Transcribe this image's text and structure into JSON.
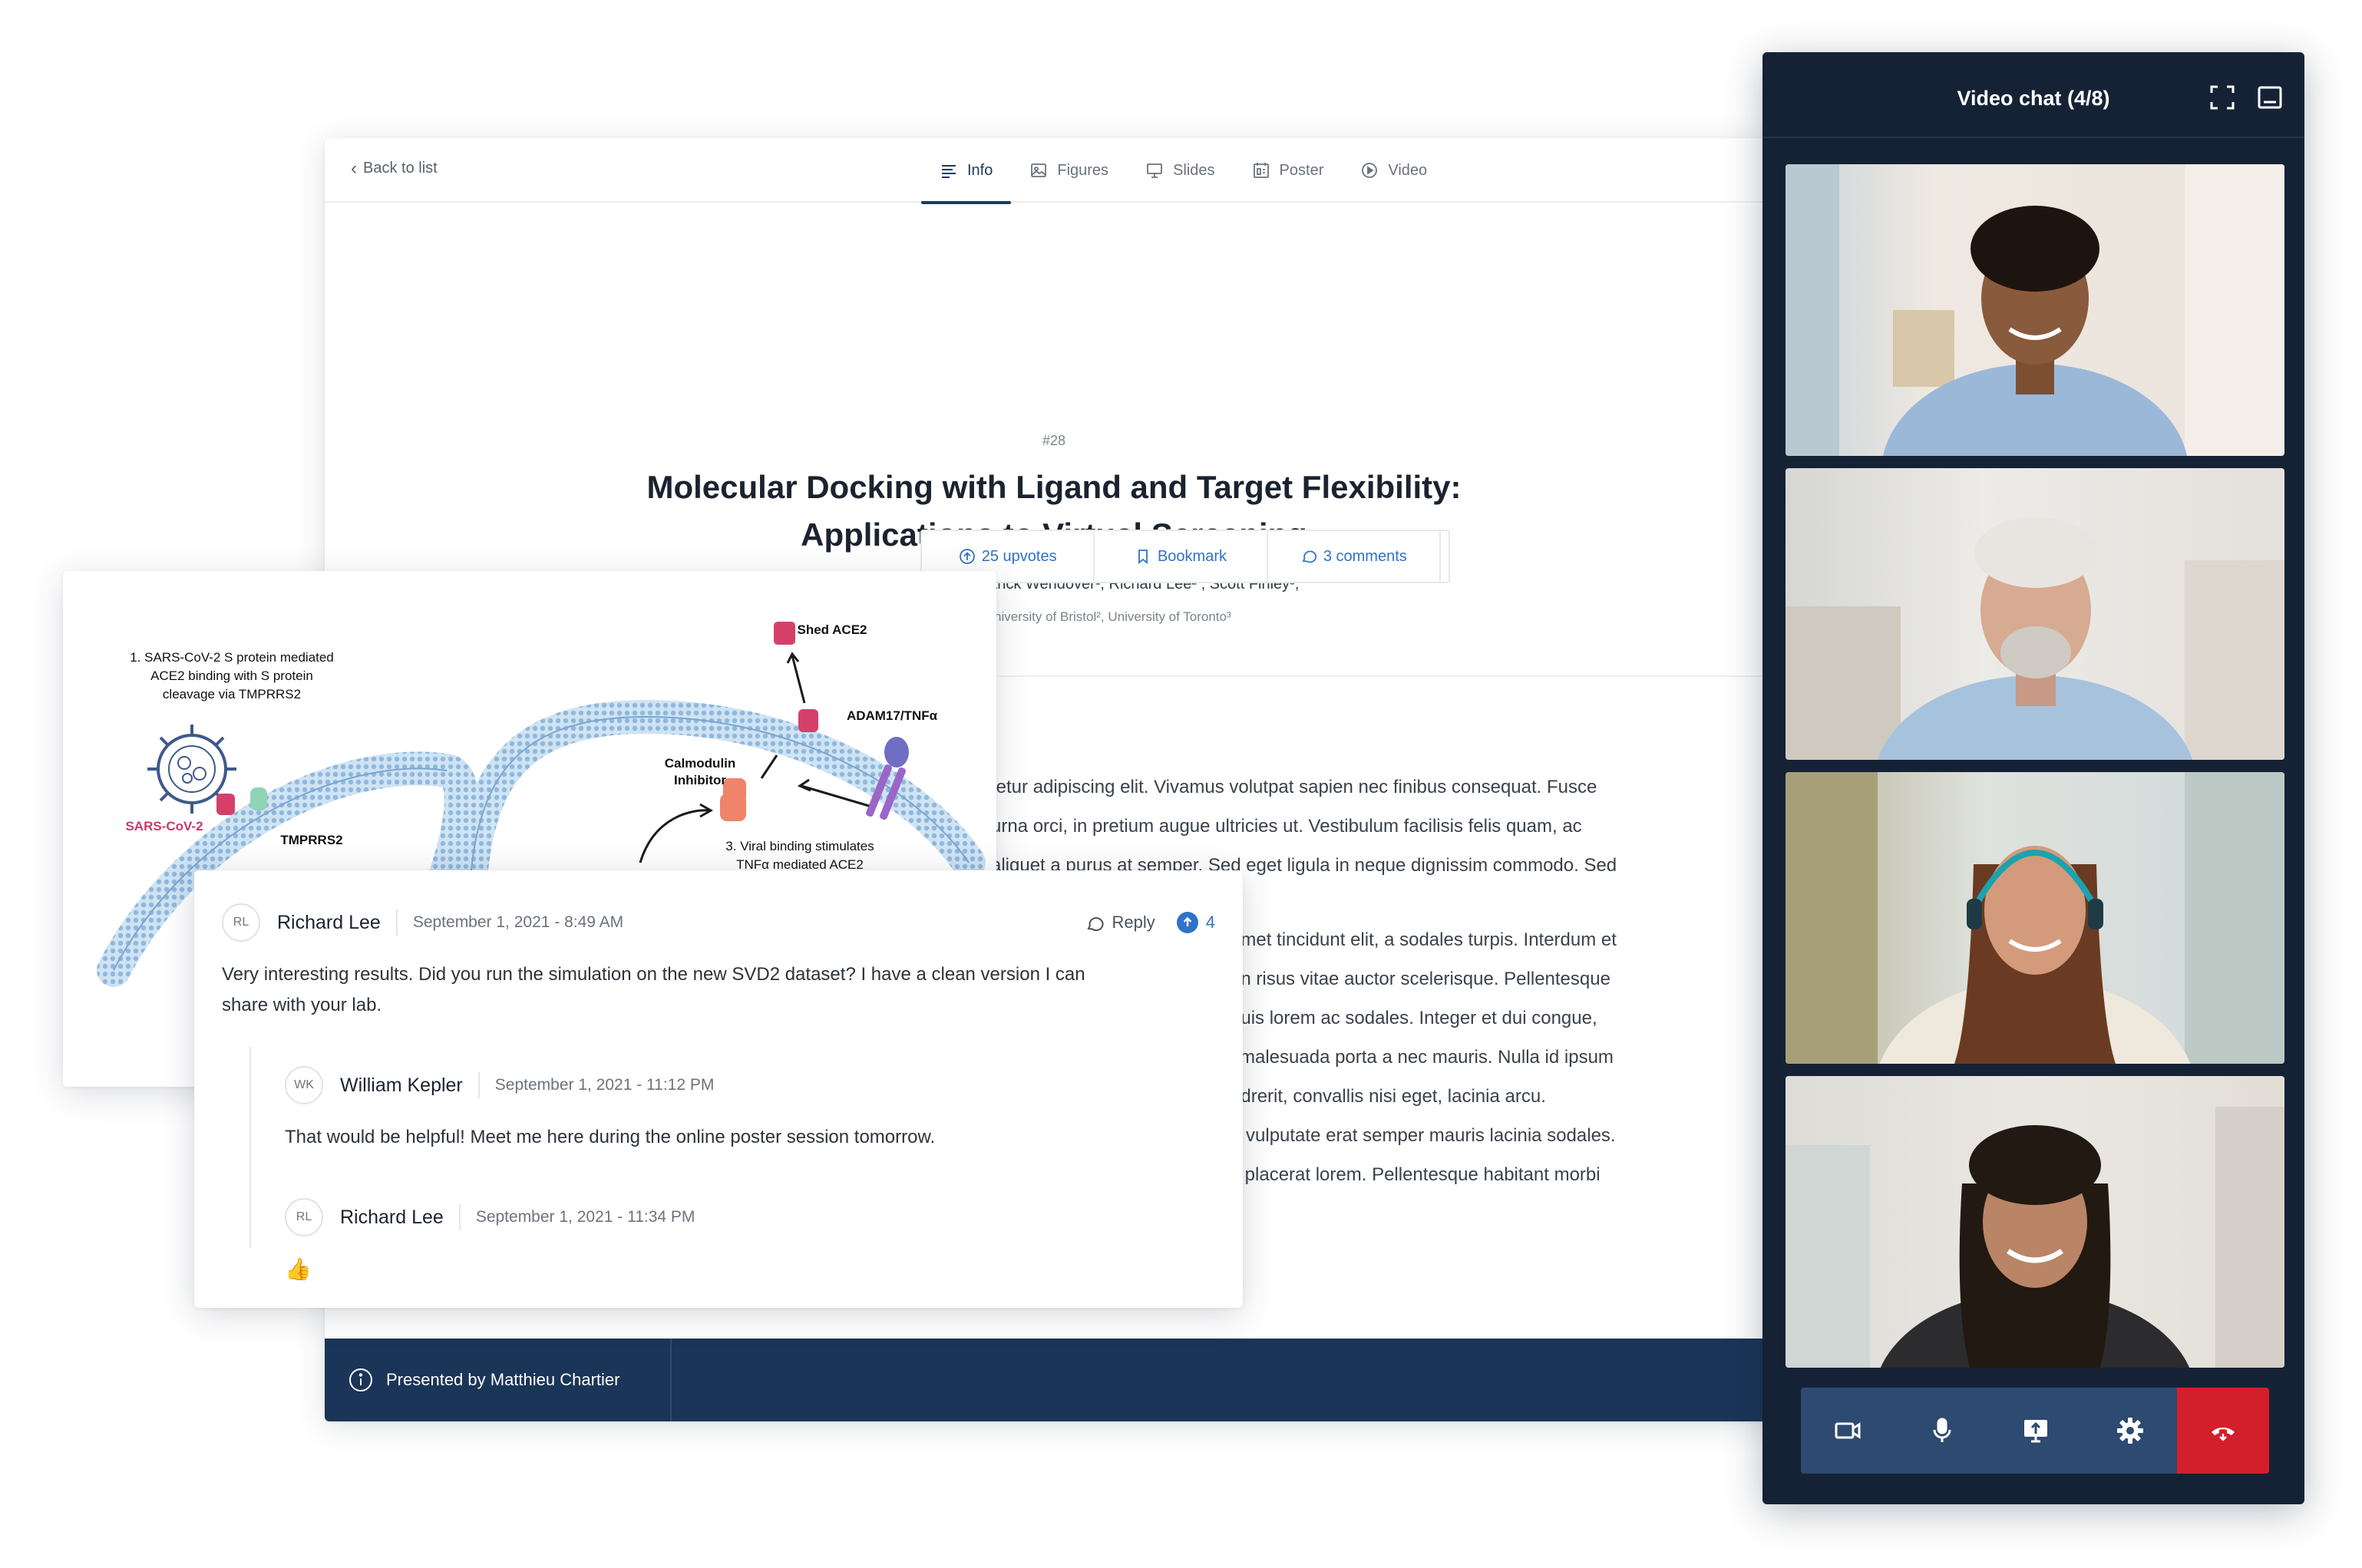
{
  "main": {
    "back_label": "Back to list",
    "tabs": [
      {
        "label": "Info",
        "icon": "info-lines-icon",
        "active": true
      },
      {
        "label": "Figures",
        "icon": "image-icon"
      },
      {
        "label": "Slides",
        "icon": "presentation-icon"
      },
      {
        "label": "Poster",
        "icon": "poster-icon"
      },
      {
        "label": "Video",
        "icon": "play-circle-icon"
      }
    ],
    "poster_number": "#28",
    "title_line1": "Molecular Docking with Ligand and Target Flexibility:",
    "title_line2": "Applications to Virtual Screening",
    "authors": "Francesco Gaudreault¹, Patrick Wendover¹, Richard Lee² , Scott Finley³,",
    "affiliations": "¹McGill University, University of Bristol², University of Toronto³",
    "actions": {
      "upvotes": "25 upvotes",
      "bookmark": "Bookmark",
      "comments": "3 comments"
    },
    "body_paragraph1": [
      "tetur adipiscing elit. Vivamus volutpat sapien nec finibus consequat. Fusce",
      "urna orci, in pretium augue ultricies ut. Vestibulum facilisis felis quam, ac",
      "aliquet a purus at semper. Sed eget ligula in neque dignissim commodo. Sed"
    ],
    "body_paragraph2": [
      "amet tincidunt elit, a sodales turpis. Interdum et",
      "an risus vitae auctor scelerisque. Pellentesque",
      "quis lorem ac sodales. Integer et dui congue,",
      "i malesuada porta a nec mauris. Nulla id ipsum",
      "ndrerit, convallis nisi eget, lacinia arcu.",
      "n vulputate erat semper mauris lacinia sodales.",
      "s placerat lorem. Pellentesque habitant morbi",
      "."
    ],
    "presented_by": "Presented by Matthieu Chartier"
  },
  "figure": {
    "step1": [
      "1. SARS-CoV-2 S protein mediated",
      "ACE2 binding with S protein",
      "cleavage via TMPRRS2"
    ],
    "virus_label": "SARS-CoV-2",
    "tmprss2_label": "TMPRRS2",
    "shed_ace2": "Shed ACE2",
    "adam17": "ADAM17/TNFα",
    "calmodulin": [
      "Calmodulin",
      "Inhibitor"
    ],
    "step3": [
      "3. Viral binding stimulates",
      "TNFα mediated ACE2"
    ]
  },
  "comments": {
    "reply_label": "Reply",
    "upvote_count": "4",
    "items": [
      {
        "initials": "RL",
        "name": "Richard Lee",
        "date": "September 1, 2021 - 8:49 AM",
        "text_line1": "Very interesting results. Did you run the simulation on the new SVD2 dataset? I have a clean version I can",
        "text_line2": "share with your lab."
      },
      {
        "initials": "WK",
        "name": "William Kepler",
        "date": "September 1, 2021 - 11:12 PM",
        "text": "That would be helpful! Meet me here during the online poster session tomorrow."
      },
      {
        "initials": "RL",
        "name": "Richard Lee",
        "date": "September 1, 2021 - 11:34 PM",
        "text": "👍"
      }
    ]
  },
  "video_chat": {
    "title": "Video chat (4/8)",
    "participants": [
      {
        "name": "participant-1",
        "skin": "#8a5a3c",
        "shirt": "#9bb8d8",
        "wall": "#e8e1d9"
      },
      {
        "name": "participant-2",
        "skin": "#d7aa92",
        "shirt": "#a7c2dd",
        "wall": "#e6e2dc"
      },
      {
        "name": "participant-3",
        "skin": "#d39b7b",
        "shirt": "#efe8dc",
        "wall": "#dfe4e6"
      },
      {
        "name": "participant-4",
        "skin": "#b98566",
        "shirt": "#2c2c2e",
        "wall": "#e4e1dc"
      }
    ],
    "controls": [
      "camera-icon",
      "microphone-icon",
      "screen-share-icon",
      "settings-gear-icon",
      "hang-up-icon"
    ],
    "colors": {
      "panel": "#152236",
      "controls": "#2d4a70",
      "hangup": "#d21f2b"
    }
  }
}
